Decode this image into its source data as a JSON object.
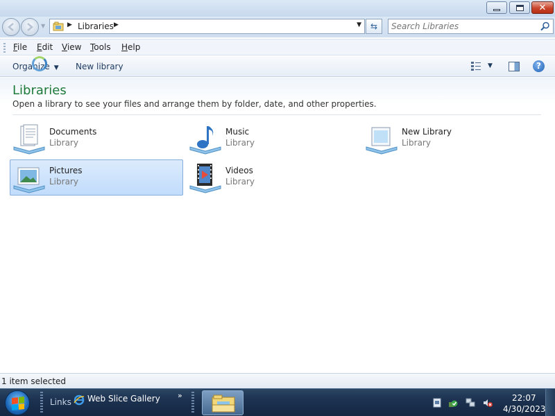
{
  "window": {
    "caption_buttons": {
      "minimize": "minimize",
      "maximize": "restore",
      "close": "✕"
    }
  },
  "address_bar": {
    "path": "Libraries",
    "search_placeholder": "Search Libraries"
  },
  "menu": {
    "items": [
      {
        "label": "File"
      },
      {
        "label": "Edit"
      },
      {
        "label": "View"
      },
      {
        "label": "Tools"
      },
      {
        "label": "Help"
      }
    ]
  },
  "command_bar": {
    "organize": "Organize",
    "new_library": "New library"
  },
  "content": {
    "title": "Libraries",
    "subtitle": "Open a library to see your files and arrange them by folder, date, and other properties.",
    "libraries": [
      {
        "name": "Documents",
        "kind": "Library",
        "icon": "documents-library-icon",
        "selected": false
      },
      {
        "name": "Music",
        "kind": "Library",
        "icon": "music-library-icon",
        "selected": false
      },
      {
        "name": "New Library",
        "kind": "Library",
        "icon": "new-library-icon",
        "selected": false
      },
      {
        "name": "Pictures",
        "kind": "Library",
        "icon": "pictures-library-icon",
        "selected": true
      },
      {
        "name": "Videos",
        "kind": "Library",
        "icon": "videos-library-icon",
        "selected": false
      }
    ]
  },
  "status_bar": {
    "text": "1 item selected"
  },
  "taskbar": {
    "links_label": "Links",
    "web_slice": "Web Slice Gallery",
    "chevron": "»",
    "clock": {
      "time": "22:07",
      "date": "4/30/2023"
    }
  },
  "colors": {
    "title_green": "#1e7a3a",
    "selection": "#c1dcfc",
    "taskbar": "#1c3250"
  }
}
